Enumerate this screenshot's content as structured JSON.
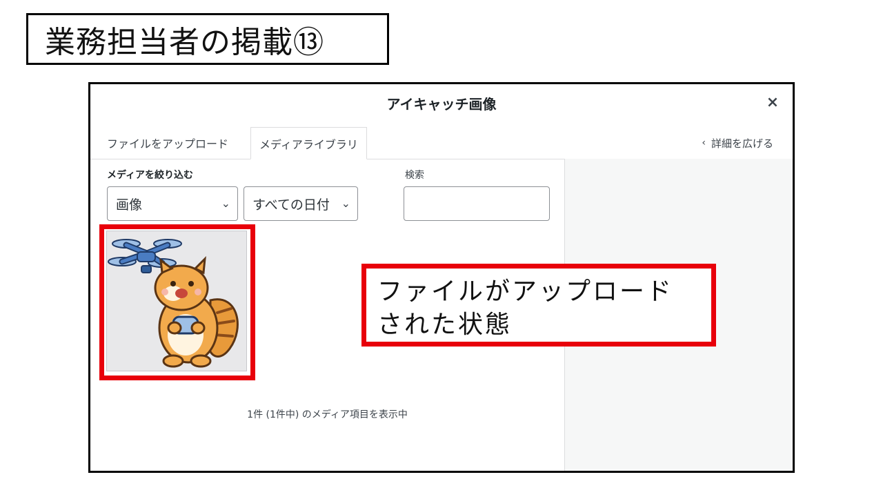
{
  "slide": {
    "title": "業務担当者の掲載⑬"
  },
  "modal": {
    "title": "アイキャッチ画像",
    "close_icon": "close-icon",
    "tabs": [
      {
        "label": "ファイルをアップロード",
        "active": false
      },
      {
        "label": "メディアライブラリ",
        "active": true
      }
    ],
    "expand_details": "詳細を広げる",
    "filter": {
      "label": "メディアを絞り込む",
      "type_selected": "画像",
      "date_selected": "すべての日付"
    },
    "search": {
      "label": "検索",
      "value": ""
    },
    "attachments": [
      {
        "name": "squirrel-drone-illustration",
        "selected": false
      }
    ],
    "count_text": "1件 (1件中) のメディア項目を表示中"
  },
  "annotation": {
    "line1": "ファイルがアップロード",
    "line2": "された状態",
    "border_color": "#e8000b"
  },
  "colors": {
    "highlight": "#e8000b",
    "sidebar_bg": "#f6f7f7"
  }
}
